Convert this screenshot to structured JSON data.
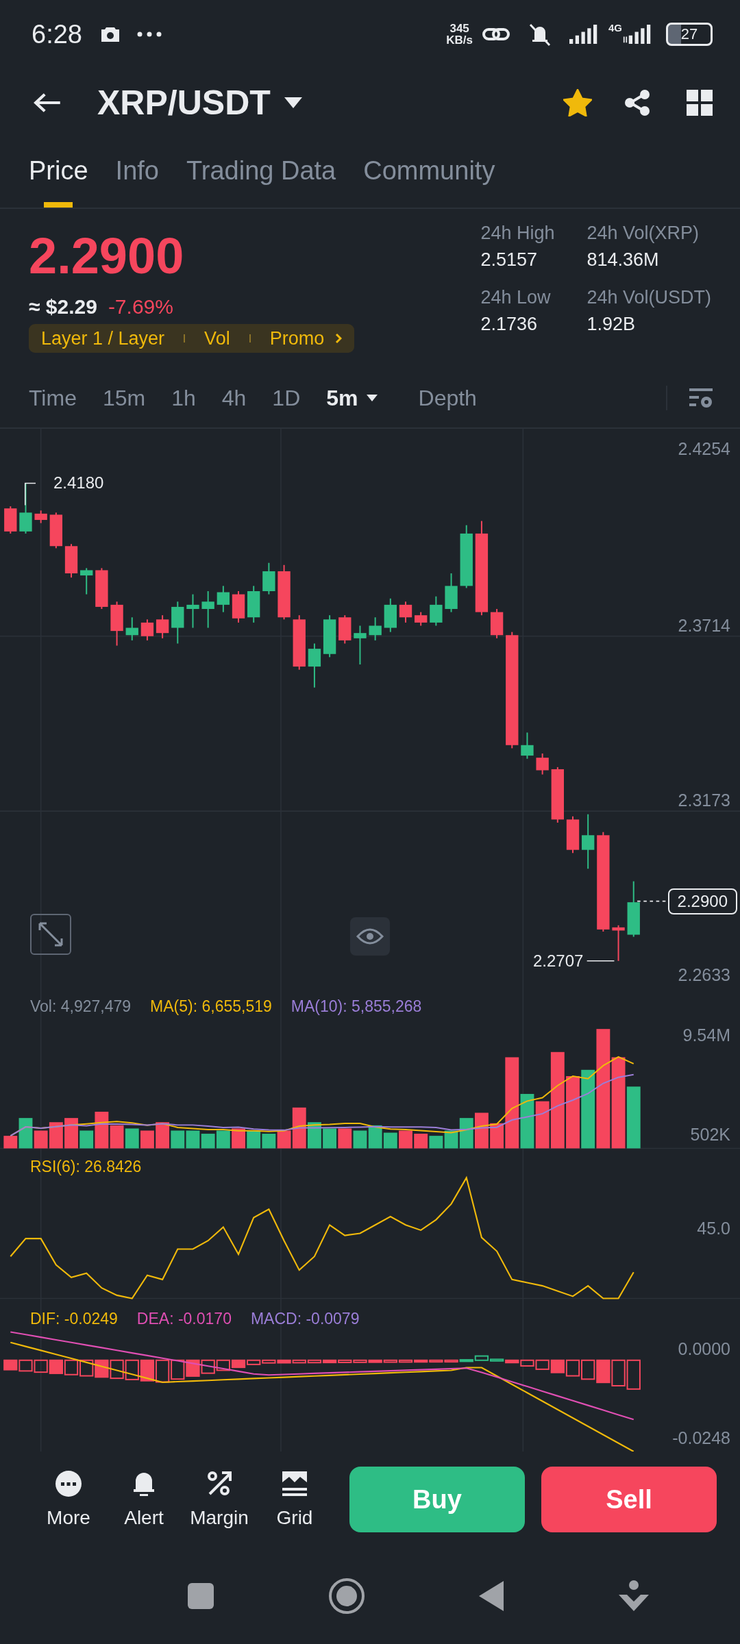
{
  "status_bar": {
    "time": "6:28",
    "speed_value": "345",
    "speed_unit": "KB/s",
    "network": "4G",
    "battery": "27"
  },
  "header": {
    "pair": "XRP/USDT",
    "favorite": true
  },
  "tabs": [
    {
      "label": "Price",
      "selected": true
    },
    {
      "label": "Info",
      "selected": false
    },
    {
      "label": "Trading Data",
      "selected": false
    },
    {
      "label": "Community",
      "selected": false
    }
  ],
  "price": {
    "last": "2.2900",
    "approx": "≈ $2.29",
    "change": "-7.69%",
    "tags": [
      "Layer 1 / Layer",
      "Vol",
      "Promo"
    ]
  },
  "stats": [
    {
      "label": "24h High",
      "value": "2.5157"
    },
    {
      "label": "24h Vol(XRP)",
      "value": "814.36M"
    },
    {
      "label": "24h Low",
      "value": "2.1736"
    },
    {
      "label": "24h Vol(USDT)",
      "value": "1.92B"
    }
  ],
  "intervals": [
    {
      "label": "Time",
      "selected": false,
      "menu": false
    },
    {
      "label": "15m",
      "selected": false,
      "menu": false
    },
    {
      "label": "1h",
      "selected": false,
      "menu": false
    },
    {
      "label": "4h",
      "selected": false,
      "menu": false
    },
    {
      "label": "1D",
      "selected": false,
      "menu": false
    },
    {
      "label": "5m",
      "selected": true,
      "menu": true
    },
    {
      "label": "Depth",
      "selected": false,
      "menu": false
    }
  ],
  "chart": {
    "y_labels": [
      "2.4254",
      "2.3714",
      "2.3173",
      "2.2633"
    ],
    "high_marker": "2.4180",
    "low_marker": "2.2707",
    "last_price": "2.2900"
  },
  "volume": {
    "vol": "Vol: 4,927,479",
    "ma5": "MA(5): 6,655,519",
    "ma10": "MA(10): 5,855,268",
    "y_labels": [
      "9.54M",
      "502K"
    ]
  },
  "rsi": {
    "label": "RSI(6): 26.8426",
    "y_label": "45.0"
  },
  "macd": {
    "dif": "DIF: -0.0249",
    "dea": "DEA: -0.0170",
    "macd": "MACD: -0.0079",
    "y_labels": [
      "0.0000",
      "-0.0248"
    ]
  },
  "actions": [
    {
      "kind": "more",
      "label": "More"
    },
    {
      "kind": "alert",
      "label": "Alert"
    },
    {
      "kind": "margin",
      "label": "Margin"
    },
    {
      "kind": "grid",
      "label": "Grid"
    }
  ],
  "buy": "Buy",
  "sell": "Sell"
}
